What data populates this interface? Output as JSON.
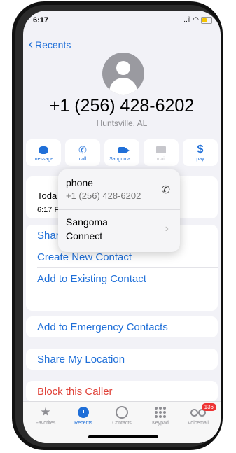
{
  "status": {
    "time": "6:17",
    "signal": "..il"
  },
  "nav": {
    "back_label": "Recents"
  },
  "contact": {
    "number": "+1 (256) 428-6202",
    "location": "Huntsville, AL"
  },
  "actions": [
    {
      "label": "message",
      "icon": "message-icon"
    },
    {
      "label": "call",
      "icon": "phone-icon"
    },
    {
      "label": "Sangoma...",
      "icon": "video-icon"
    },
    {
      "label": "mail",
      "icon": "mail-icon"
    },
    {
      "label": "pay",
      "icon": "dollar-icon",
      "glyph": "$"
    }
  ],
  "recent": {
    "day": "Toda",
    "time": "6:17 F"
  },
  "popup": {
    "item1_title": "phone",
    "item1_sub": "+1 (256) 428-6202",
    "item2_title_line1": "Sangoma",
    "item2_title_line2": "Connect"
  },
  "options": {
    "share": "Shar",
    "create": "Create New Contact",
    "add_existing": "Add to Existing Contact",
    "emergency": "Add to Emergency Contacts",
    "share_location": "Share My Location",
    "block": "Block this Caller"
  },
  "tabs": [
    {
      "label": "Favorites"
    },
    {
      "label": "Recents"
    },
    {
      "label": "Contacts"
    },
    {
      "label": "Keypad"
    },
    {
      "label": "Voicemail",
      "badge": "136"
    }
  ],
  "colors": {
    "accent": "#1f6fd8",
    "danger": "#e0433a",
    "background": "#f2f2f7"
  }
}
